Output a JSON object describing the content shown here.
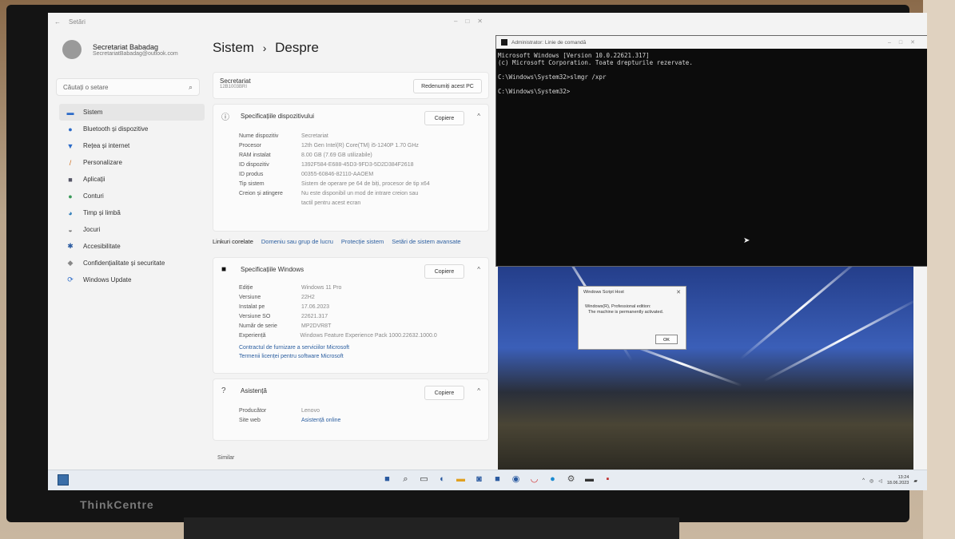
{
  "settings": {
    "window_title": "Setări",
    "profile": {
      "name": "Secretariat Babadag",
      "email": "SecretariatBabadag@outlook.com"
    },
    "search_placeholder": "Căutați o setare",
    "nav": [
      {
        "label": "Sistem",
        "icon": "monitor-icon"
      },
      {
        "label": "Bluetooth și dispozitive",
        "icon": "bluetooth-icon"
      },
      {
        "label": "Rețea și internet",
        "icon": "wifi-icon"
      },
      {
        "label": "Personalizare",
        "icon": "brush-icon"
      },
      {
        "label": "Aplicații",
        "icon": "apps-icon"
      },
      {
        "label": "Conturi",
        "icon": "account-icon"
      },
      {
        "label": "Timp și limbă",
        "icon": "globe-icon"
      },
      {
        "label": "Jocuri",
        "icon": "gamepad-icon"
      },
      {
        "label": "Accesibilitate",
        "icon": "accessibility-icon"
      },
      {
        "label": "Confidențialitate și securitate",
        "icon": "shield-icon"
      },
      {
        "label": "Windows Update",
        "icon": "update-icon"
      }
    ],
    "breadcrumb": {
      "parent": "Sistem",
      "separator": "›",
      "current": "Despre"
    },
    "pc": {
      "name": "Secretariat",
      "model": "12B1003BRI",
      "rename_label": "Redenumiți acest PC"
    },
    "device_specs": {
      "title": "Specificațiile dispozitivului",
      "copy_label": "Copiere",
      "rows": [
        {
          "k": "Nume dispozitiv",
          "v": "Secretariat"
        },
        {
          "k": "Procesor",
          "v": "12th Gen Intel(R) Core(TM) i5-1240P   1.70 GHz"
        },
        {
          "k": "RAM instalat",
          "v": "8.00 GB (7.69 GB utilizabile)"
        },
        {
          "k": "ID dispozitiv",
          "v": "1392F584-E688-45D3-9FD3-5D2D384F2618"
        },
        {
          "k": "ID produs",
          "v": "00355-60846-82110-AAOEM"
        },
        {
          "k": "Tip sistem",
          "v": "Sistem de operare pe 64 de biți, procesor de tip x64"
        },
        {
          "k": "Creion și atingere",
          "v": "Nu este disponibil un mod de intrare creion sau tactil pentru acest ecran"
        }
      ]
    },
    "related_links": {
      "label": "Linkuri corelate",
      "links": [
        "Domeniu sau grup de lucru",
        "Protecție sistem",
        "Setări de sistem avansate"
      ]
    },
    "windows_specs": {
      "title": "Specificațiile Windows",
      "copy_label": "Copiere",
      "rows": [
        {
          "k": "Ediție",
          "v": "Windows 11 Pro"
        },
        {
          "k": "Versiune",
          "v": "22H2"
        },
        {
          "k": "Instalat pe",
          "v": "17.06.2023"
        },
        {
          "k": "Versiune SO",
          "v": "22621.317"
        },
        {
          "k": "Număr de serie",
          "v": "MP2DVR8T"
        },
        {
          "k": "Experiență",
          "v": "Windows Feature Experience Pack 1000.22632.1000.0"
        }
      ],
      "links": [
        "Contractul de furnizare a serviciilor Microsoft",
        "Termenii licenței pentru software Microsoft"
      ]
    },
    "support": {
      "title": "Asistență",
      "copy_label": "Copiere",
      "rows": [
        {
          "k": "Producător",
          "v": "Lenovo"
        },
        {
          "k": "Site web",
          "v": "Asistență online"
        }
      ]
    },
    "similar_label": "Similar"
  },
  "cmd": {
    "title": "Administrator: Linie de comandă",
    "lines": [
      "Microsoft Windows [Version 10.0.22621.317]",
      "(c) Microsoft Corporation. Toate drepturile rezervate.",
      "",
      "C:\\Windows\\System32>slmgr /xpr",
      "",
      "C:\\Windows\\System32>"
    ]
  },
  "dialog": {
    "title": "Windows Script Host",
    "line1": "Windows(R), Professional edition:",
    "line2": "The machine is permanently activated.",
    "ok": "OK"
  },
  "taskbar": {
    "time": "13:24",
    "date": "18.06.2023"
  },
  "brand": "ThinkCentre"
}
